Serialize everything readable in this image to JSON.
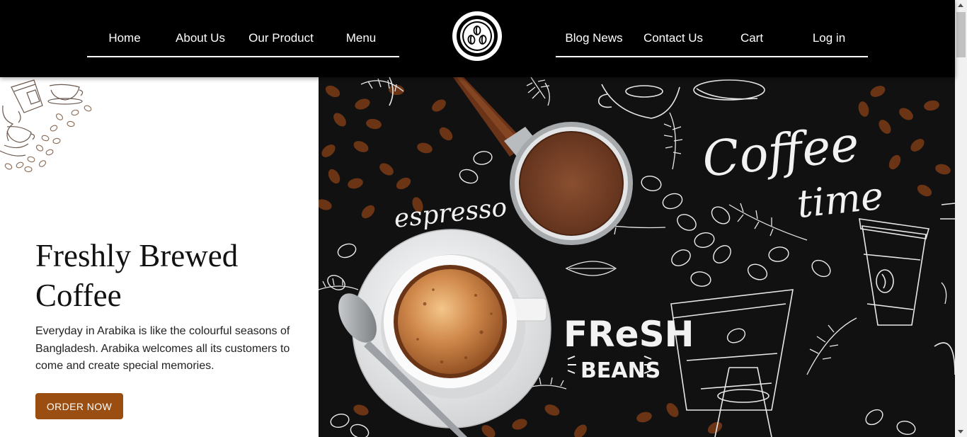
{
  "nav": {
    "left": [
      "Home",
      "About Us",
      "Our Product",
      "Menu"
    ],
    "right": [
      "Blog News",
      "Contact Us",
      "Cart",
      "Log in"
    ],
    "logo_icon": "coffee-beans-logo-icon"
  },
  "hero": {
    "title_line1": "Freshly Brewed",
    "title_line2": "Coffee",
    "description": "Everyday in Arabika is like the colourful seasons of Bangladesh. Arabika welcomes all its customers to come and create special memories.",
    "cta_label": "ORDER NOW",
    "image_text": {
      "espresso": "espresso",
      "coffee_time_1": "Coffee",
      "coffee_time_2": "time",
      "fresh": "FReSH",
      "beans": "BEANS"
    }
  },
  "colors": {
    "nav_bg": "#000000",
    "accent": "#9b4e12",
    "image_bg": "#111111"
  }
}
